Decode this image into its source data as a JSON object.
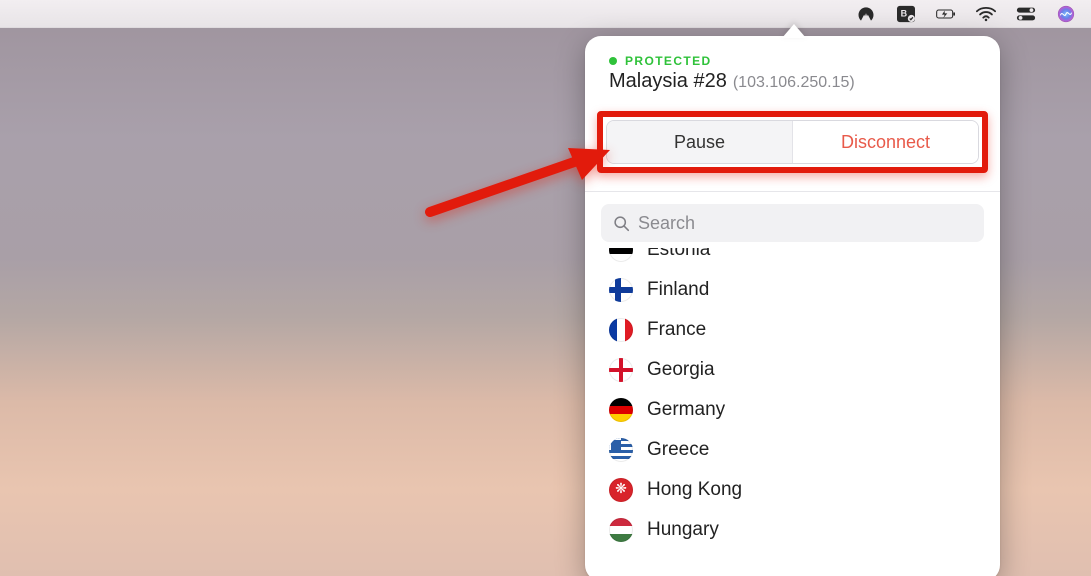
{
  "menubar": {
    "icons": [
      "nordvpn-icon",
      "app-badge-icon",
      "battery-charging-icon",
      "wifi-icon",
      "control-center-icon",
      "siri-icon"
    ]
  },
  "vpn": {
    "status_label": "PROTECTED",
    "server_name": "Malaysia #28",
    "server_ip": "(103.106.250.15)",
    "pause_label": "Pause",
    "disconnect_label": "Disconnect",
    "search_placeholder": "Search",
    "countries": [
      {
        "name": "Estonia",
        "flag": "estonia"
      },
      {
        "name": "Finland",
        "flag": "finland"
      },
      {
        "name": "France",
        "flag": "france"
      },
      {
        "name": "Georgia",
        "flag": "georgia"
      },
      {
        "name": "Germany",
        "flag": "germany"
      },
      {
        "name": "Greece",
        "flag": "greece"
      },
      {
        "name": "Hong Kong",
        "flag": "hongkong"
      },
      {
        "name": "Hungary",
        "flag": "hungary"
      }
    ]
  }
}
